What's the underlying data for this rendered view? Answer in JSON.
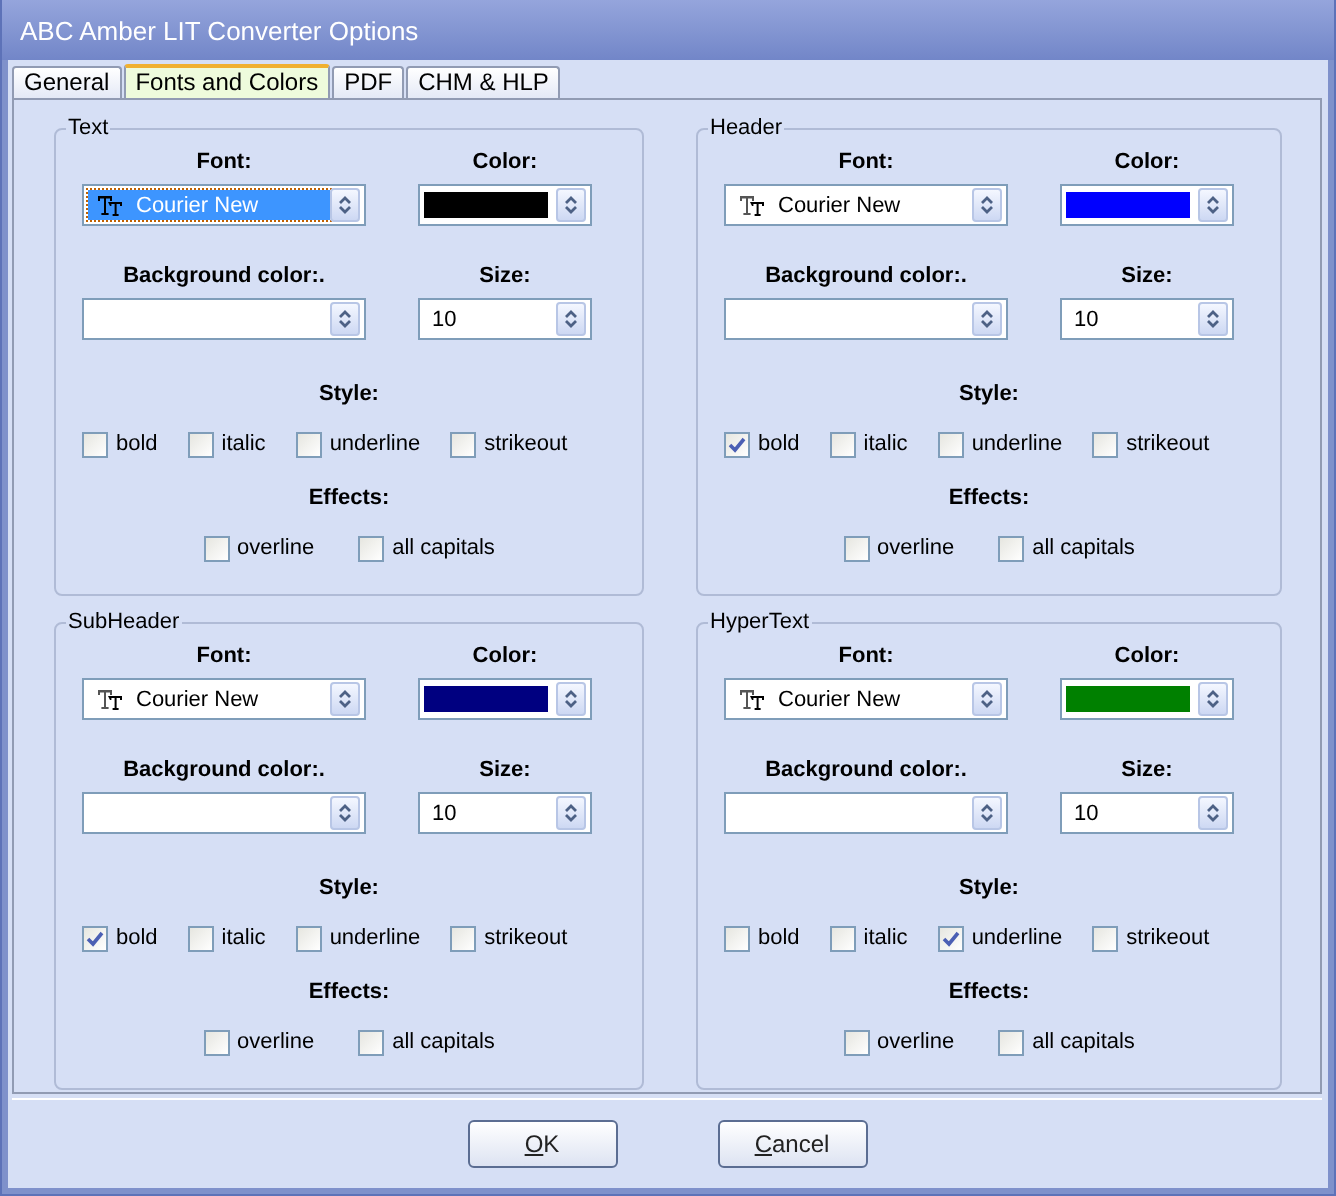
{
  "window": {
    "title": "ABC Amber LIT Converter Options"
  },
  "tabs": [
    {
      "label": "General",
      "selected": false
    },
    {
      "label": "Fonts and Colors",
      "selected": true
    },
    {
      "label": "PDF",
      "selected": false
    },
    {
      "label": "CHM & HLP",
      "selected": false
    }
  ],
  "groups": [
    {
      "title": "Text",
      "font_label": "Font:",
      "font": "Courier New",
      "font_focused": true,
      "color_label": "Color:",
      "color": "#000000",
      "background_label": "Background color:.",
      "size_label": "Size:",
      "size": "10",
      "style_label": "Style:",
      "styles": [
        {
          "label": "bold",
          "checked": false
        },
        {
          "label": "italic",
          "checked": false
        },
        {
          "label": "underline",
          "checked": false
        },
        {
          "label": "strikeout",
          "checked": false
        }
      ],
      "effects_label": "Effects:",
      "effects": [
        {
          "label": "overline",
          "checked": false
        },
        {
          "label": "all capitals",
          "checked": false
        }
      ]
    },
    {
      "title": "Header",
      "font_label": "Font:",
      "font": "Courier New",
      "font_focused": false,
      "color_label": "Color:",
      "color": "#0000ff",
      "background_label": "Background color:.",
      "size_label": "Size:",
      "size": "10",
      "style_label": "Style:",
      "styles": [
        {
          "label": "bold",
          "checked": true
        },
        {
          "label": "italic",
          "checked": false
        },
        {
          "label": "underline",
          "checked": false
        },
        {
          "label": "strikeout",
          "checked": false
        }
      ],
      "effects_label": "Effects:",
      "effects": [
        {
          "label": "overline",
          "checked": false
        },
        {
          "label": "all capitals",
          "checked": false
        }
      ]
    },
    {
      "title": "SubHeader",
      "font_label": "Font:",
      "font": "Courier New",
      "font_focused": false,
      "color_label": "Color:",
      "color": "#000080",
      "background_label": "Background color:.",
      "size_label": "Size:",
      "size": "10",
      "style_label": "Style:",
      "styles": [
        {
          "label": "bold",
          "checked": true
        },
        {
          "label": "italic",
          "checked": false
        },
        {
          "label": "underline",
          "checked": false
        },
        {
          "label": "strikeout",
          "checked": false
        }
      ],
      "effects_label": "Effects:",
      "effects": [
        {
          "label": "overline",
          "checked": false
        },
        {
          "label": "all capitals",
          "checked": false
        }
      ]
    },
    {
      "title": "HyperText",
      "font_label": "Font:",
      "font": "Courier New",
      "font_focused": false,
      "color_label": "Color:",
      "color": "#008000",
      "background_label": "Background color:.",
      "size_label": "Size:",
      "size": "10",
      "style_label": "Style:",
      "styles": [
        {
          "label": "bold",
          "checked": false
        },
        {
          "label": "italic",
          "checked": false
        },
        {
          "label": "underline",
          "checked": true
        },
        {
          "label": "strikeout",
          "checked": false
        }
      ],
      "effects_label": "Effects:",
      "effects": [
        {
          "label": "overline",
          "checked": false
        },
        {
          "label": "all capitals",
          "checked": false
        }
      ]
    }
  ],
  "buttons": [
    "OK",
    "Cancel"
  ]
}
